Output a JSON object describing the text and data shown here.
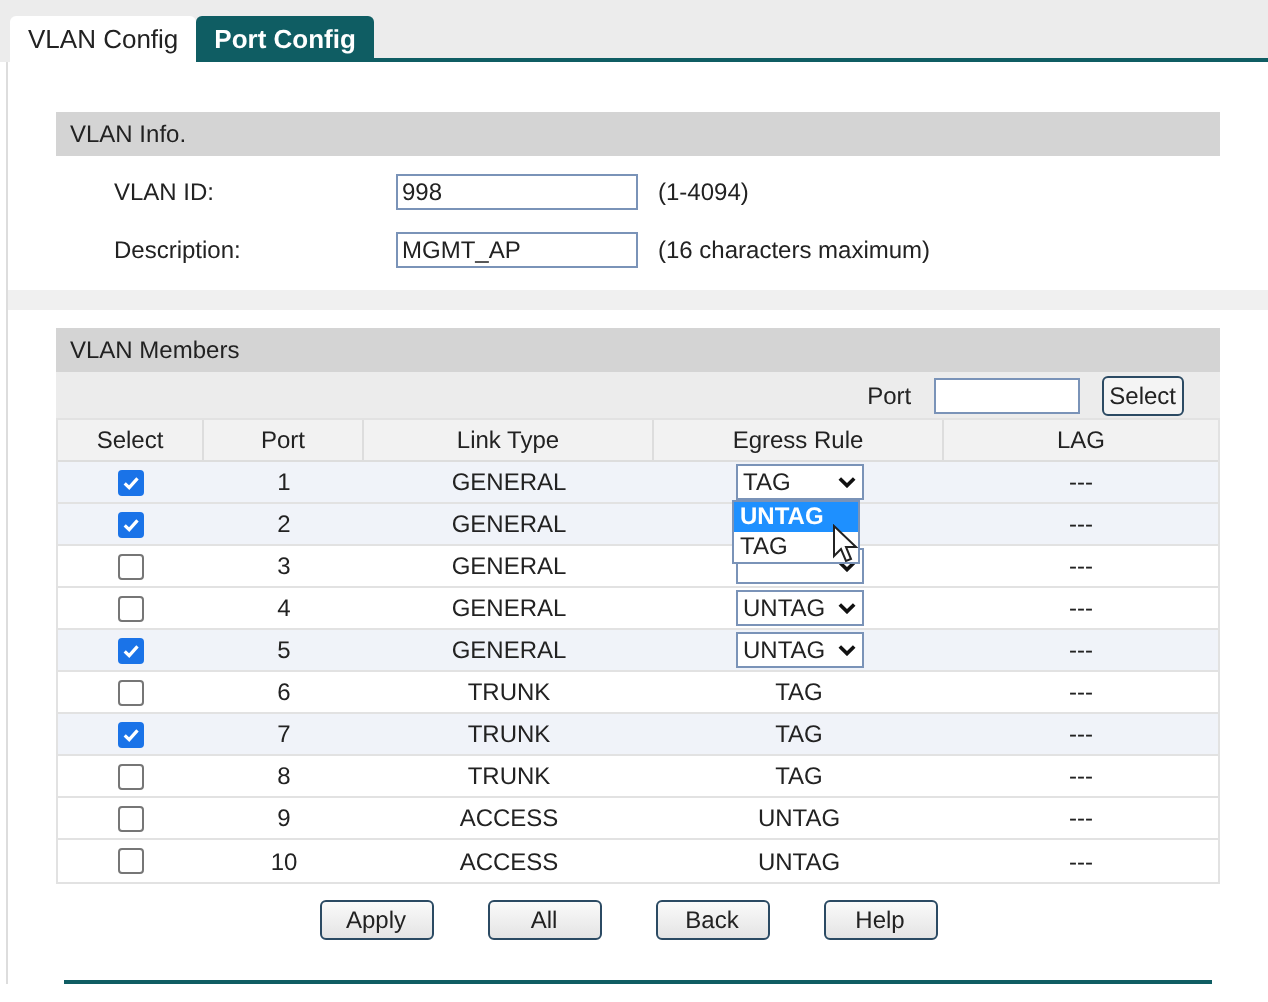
{
  "tabs": [
    {
      "label": "VLAN Config",
      "selected": true
    },
    {
      "label": "Port Config",
      "selected": false
    }
  ],
  "vlan_info": {
    "title": "VLAN Info.",
    "fields": [
      {
        "label": "VLAN ID:",
        "value": "998",
        "hint": "(1-4094)"
      },
      {
        "label": "Description:",
        "value": "MGMT_AP",
        "hint": "(16 characters maximum)"
      }
    ]
  },
  "vlan_members": {
    "title": "VLAN Members",
    "port_search": {
      "label": "Port",
      "button": "Select"
    },
    "columns": [
      "Select",
      "Port",
      "Link Type",
      "Egress Rule",
      "LAG"
    ],
    "rows": [
      {
        "kind": "select",
        "checked": true,
        "port": "1",
        "link_type": "GENERAL",
        "egress": "TAG",
        "lag": "---"
      },
      {
        "kind": "covered",
        "checked": true,
        "port": "2",
        "link_type": "GENERAL",
        "lag": "---"
      },
      {
        "kind": "select",
        "checked": false,
        "port": "3",
        "link_type": "GENERAL",
        "lag": "---"
      },
      {
        "kind": "select",
        "checked": false,
        "port": "4",
        "link_type": "GENERAL",
        "egress": "UNTAG",
        "lag": "---"
      },
      {
        "kind": "select",
        "checked": true,
        "port": "5",
        "link_type": "GENERAL",
        "egress": "UNTAG",
        "lag": "---"
      },
      {
        "kind": "text",
        "checked": false,
        "port": "6",
        "link_type": "TRUNK",
        "egress": "TAG",
        "lag": "---"
      },
      {
        "kind": "text",
        "checked": true,
        "port": "7",
        "link_type": "TRUNK",
        "egress": "TAG",
        "lag": "---"
      },
      {
        "kind": "text",
        "checked": false,
        "port": "8",
        "link_type": "TRUNK",
        "egress": "TAG",
        "lag": "---"
      },
      {
        "kind": "text",
        "checked": false,
        "port": "9",
        "link_type": "ACCESS",
        "egress": "UNTAG",
        "lag": "---"
      },
      {
        "kind": "text",
        "checked": false,
        "port": "10",
        "link_type": "ACCESS",
        "egress": "UNTAG",
        "lag": "---"
      }
    ],
    "dropdown": {
      "options": [
        {
          "label": "UNTAG",
          "selected": true
        },
        {
          "label": "TAG",
          "selected": false
        }
      ]
    }
  },
  "buttons": [
    "Apply",
    "All",
    "Back",
    "Help"
  ]
}
